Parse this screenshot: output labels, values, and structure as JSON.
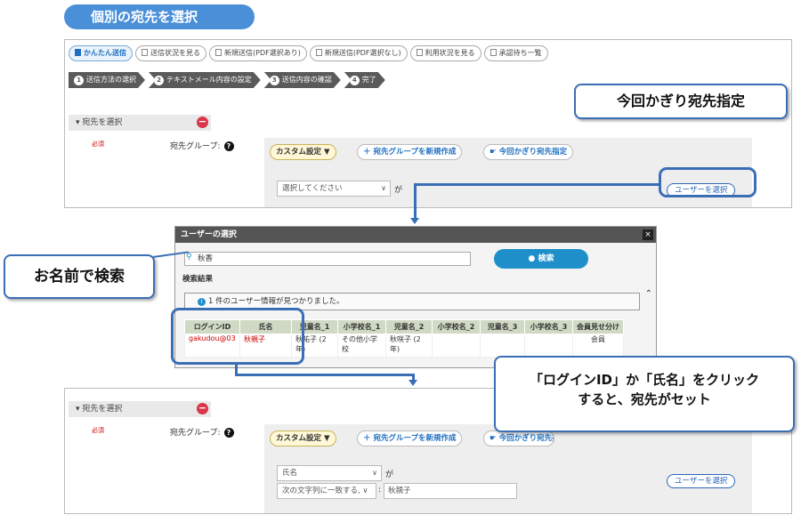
{
  "header": {
    "title": "個別の宛先を選択"
  },
  "tabs": [
    {
      "label": "かんたん送信",
      "active": true
    },
    {
      "label": "送信状況を見る",
      "active": false
    },
    {
      "label": "新規送信(PDF選択あり)",
      "active": false
    },
    {
      "label": "新規送信(PDF選択なし)",
      "active": false
    },
    {
      "label": "利用状況を見る",
      "active": false
    },
    {
      "label": "承認待ち一覧",
      "active": false
    }
  ],
  "steps": [
    {
      "num": "1",
      "label": "送信方法の選択"
    },
    {
      "num": "2",
      "label": "テキストメール内容の設定"
    },
    {
      "num": "3",
      "label": "送信内容の確認"
    },
    {
      "num": "4",
      "label": "完了"
    }
  ],
  "section": {
    "title": "宛先を選択",
    "required": "必須",
    "group_label": "宛先グループ:",
    "help": "?"
  },
  "buttons": {
    "custom": "カスタム設定",
    "new_group": "宛先グループを新規作成",
    "temp_dest": "今回かぎり宛先指定",
    "select_user": "ユーザーを選択"
  },
  "top_form": {
    "select_placeholder": "選択してください",
    "suffix": "が"
  },
  "callouts": {
    "temp_dest": "今回かぎり宛先指定",
    "search_name": "お名前で検索",
    "click_hint_line1": "「ログインID」か「氏名」をクリック",
    "click_hint_line2": "すると、宛先がセット"
  },
  "dialog": {
    "title": "ユーザーの選択",
    "close": "×",
    "search_value": "秋香",
    "search_button": "検索",
    "results_label": "検索結果",
    "found_message": "1 件のユーザー情報が見つかりました。",
    "columns": [
      "ログインID",
      "氏名",
      "児童名_1",
      "小学校名_1",
      "児童名_2",
      "小学校名_2",
      "児童名_3",
      "小学校名_3",
      "会員見せ分け"
    ],
    "rows": [
      [
        "gakudou@03",
        "秋親子",
        "秋祐子 (2年)",
        "その他小学校",
        "秋咲子 (2年)",
        "",
        "",
        "",
        "会員"
      ]
    ]
  },
  "bottom_form": {
    "field_select": "氏名",
    "suffix": "が",
    "condition_select": "次の文字列に一致する, ∨",
    "colon": ":",
    "value": "秋親子"
  },
  "colors": {
    "accent": "#3b6fb5",
    "header": "#4a90d9",
    "required": "#cc0000"
  }
}
